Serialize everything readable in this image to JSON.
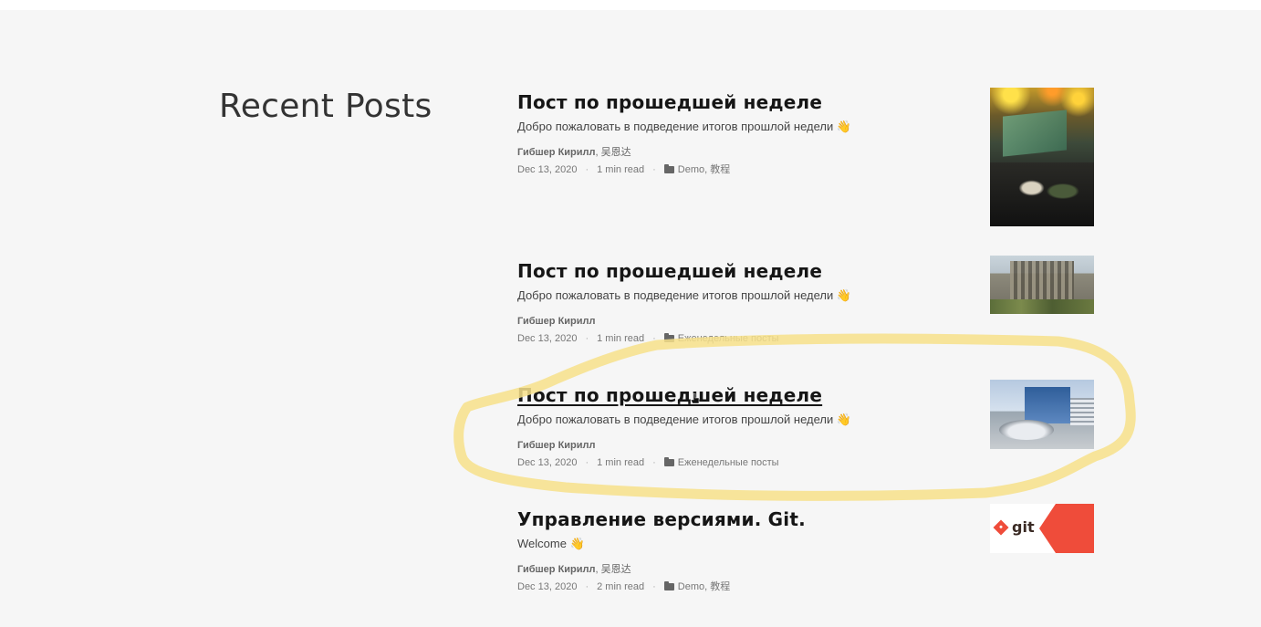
{
  "section": {
    "heading": "Recent Posts"
  },
  "posts": [
    {
      "title": "Пост по прошедшей неделе",
      "excerpt": "Добро пожаловать в подведение итогов прошлой недели",
      "emoji": "👋",
      "author_main": "Гибшер Кирилл",
      "author_extra": ", 吴恩达",
      "date": "Dec 13, 2020",
      "read_time": "1 min read",
      "categories": "Demo, 教程"
    },
    {
      "title": "Пост по прошедшей неделе",
      "excerpt": "Добро пожаловать в подведение итогов прошлой недели",
      "emoji": "👋",
      "author_main": "Гибшер Кирилл",
      "author_extra": "",
      "date": "Dec 13, 2020",
      "read_time": "1 min read",
      "categories": "Еженедельные посты"
    },
    {
      "title": "Пост по прошедшей неделе",
      "excerpt": "Добро пожаловать в подведение итогов прошлой недели",
      "emoji": "👋",
      "author_main": "Гибшер Кирилл",
      "author_extra": "",
      "date": "Dec 13, 2020",
      "read_time": "1 min read",
      "categories": "Еженедельные посты"
    },
    {
      "title": "Управление версиями. Git.",
      "excerpt": "Welcome",
      "emoji": "👋",
      "author_main": "Гибшер Кирилл",
      "author_extra": ", 吴恩达",
      "date": "Dec 13, 2020",
      "read_time": "2 min read",
      "categories": "Demo, 教程"
    }
  ],
  "thumbnails": {
    "git_label": "git"
  },
  "meta_separator": "·",
  "colors": {
    "background": "#f6f6f6",
    "highlight": "#f7e08a",
    "git_red": "#ef4c3a"
  },
  "icons": [
    "folder-icon",
    "cursor-icon",
    "waving-hand-icon"
  ]
}
